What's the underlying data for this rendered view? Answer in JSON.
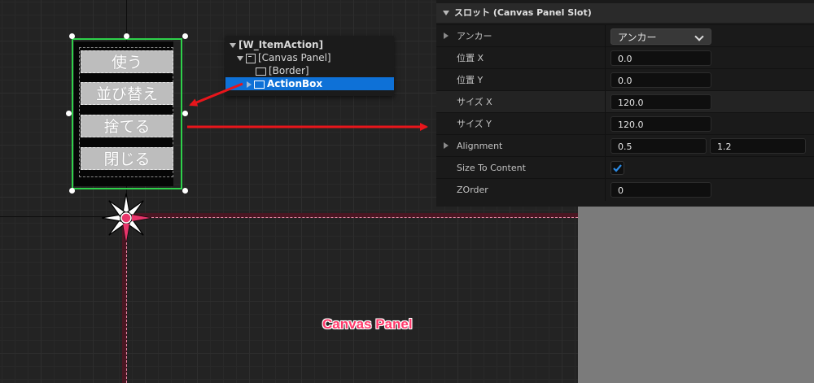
{
  "canvas": {
    "label": "Canvas Panel",
    "colors": {
      "frame": "#4a1622",
      "label": "#ff3a6b",
      "selection": "#2ed14a"
    }
  },
  "widget": {
    "buttons": [
      "使う",
      "並び替え",
      "捨てる",
      "閉じる"
    ]
  },
  "hierarchy": {
    "root": "[W_ItemAction]",
    "canvas_panel": "[Canvas Panel]",
    "border": "[Border]",
    "action_box": "ActionBox"
  },
  "details": {
    "section_title": "スロット (Canvas Panel Slot)",
    "anchors": {
      "label": "アンカー",
      "value": "アンカー"
    },
    "position_x": {
      "label": "位置 X",
      "value": "0.0"
    },
    "position_y": {
      "label": "位置 Y",
      "value": "0.0"
    },
    "size_x": {
      "label": "サイズ X",
      "value": "120.0"
    },
    "size_y": {
      "label": "サイズ Y",
      "value": "120.0"
    },
    "alignment": {
      "label": "Alignment",
      "x": "0.5",
      "y": "1.2"
    },
    "size_to_content": {
      "label": "Size To Content",
      "checked": true
    },
    "zorder": {
      "label": "ZOrder",
      "value": "0"
    }
  },
  "annotation_color": "#e8151b"
}
